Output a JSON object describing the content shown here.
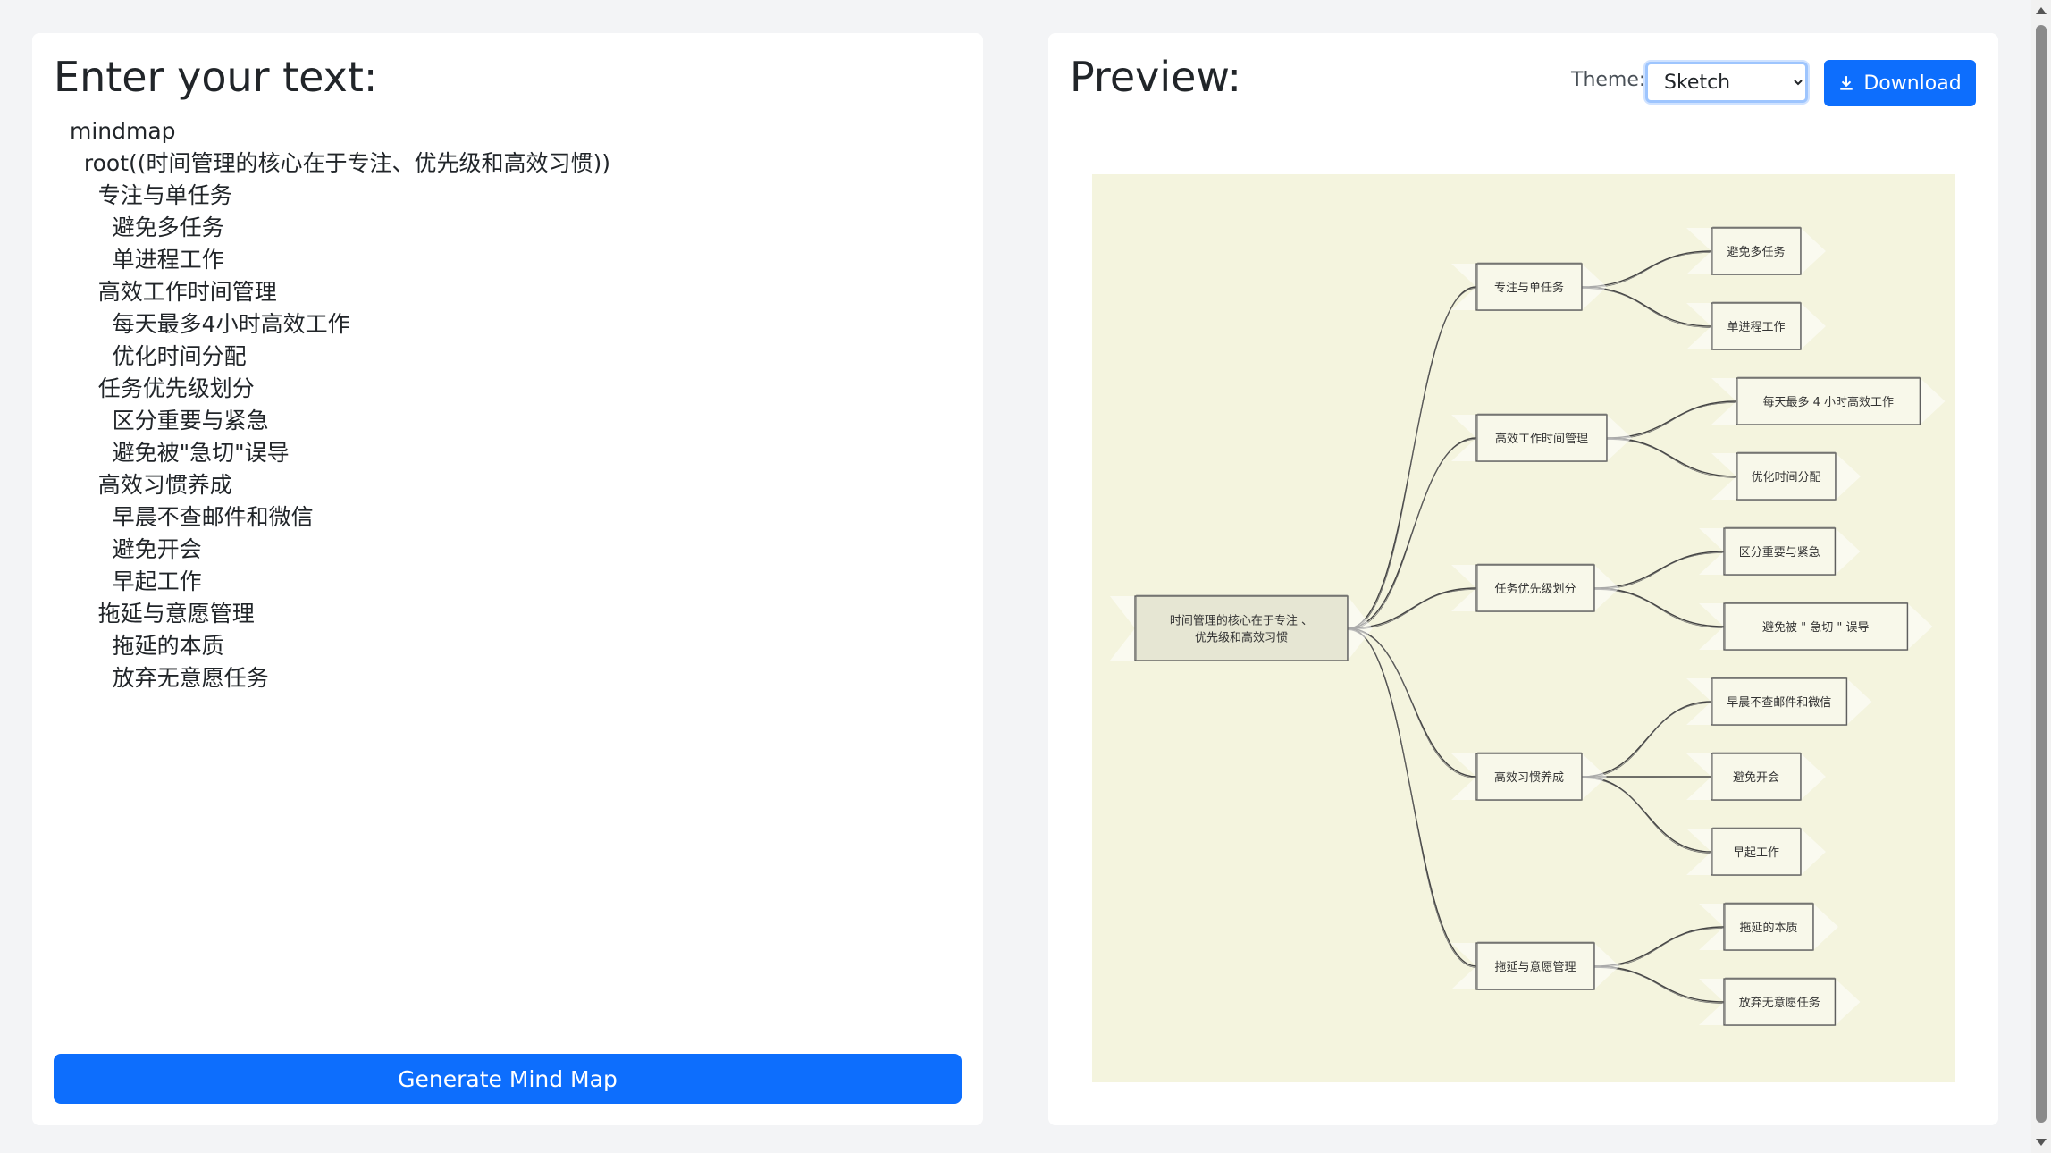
{
  "editor": {
    "title": "Enter your text:",
    "text": "mindmap\n  root((时间管理的核心在于专注、优先级和高效习惯))\n    专注与单任务\n      避免多任务\n      单进程工作\n    高效工作时间管理\n      每天最多4小时高效工作\n      优化时间分配\n    任务优先级划分\n      区分重要与紧急\n      避免被\"急切\"误导\n    高效习惯养成\n      早晨不查邮件和微信\n      避免开会\n      早起工作\n    拖延与意愿管理\n      拖延的本质\n      放弃无意愿任务",
    "generate_label": "Generate Mind Map"
  },
  "preview": {
    "title": "Preview:",
    "theme_label": "Theme:",
    "theme_value": "Sketch",
    "download_label": "Download",
    "download_icon": "download-icon",
    "canvas_bg": "#f4f4de"
  },
  "mindmap": {
    "root": [
      "时间管理的核心在于专注 、",
      "优先级和高效习惯"
    ],
    "branches": [
      {
        "label": "专注与单任务",
        "children": [
          "避免多任务",
          "单进程工作"
        ]
      },
      {
        "label": "高效工作时间管理",
        "children": [
          "每天最多 4 小时高效工作",
          "优化时间分配"
        ]
      },
      {
        "label": "任务优先级划分",
        "children": [
          "区分重要与紧急",
          "避免被 \" 急切 \" 误导"
        ]
      },
      {
        "label": "高效习惯养成",
        "children": [
          "早晨不查邮件和微信",
          "避免开会",
          "早起工作"
        ]
      },
      {
        "label": "拖延与意愿管理",
        "children": [
          "拖延的本质",
          "放弃无意愿任务"
        ]
      }
    ]
  },
  "colors": {
    "accent": "#0d6efd",
    "page_bg": "#f3f4f6",
    "panel_bg": "#ffffff"
  }
}
